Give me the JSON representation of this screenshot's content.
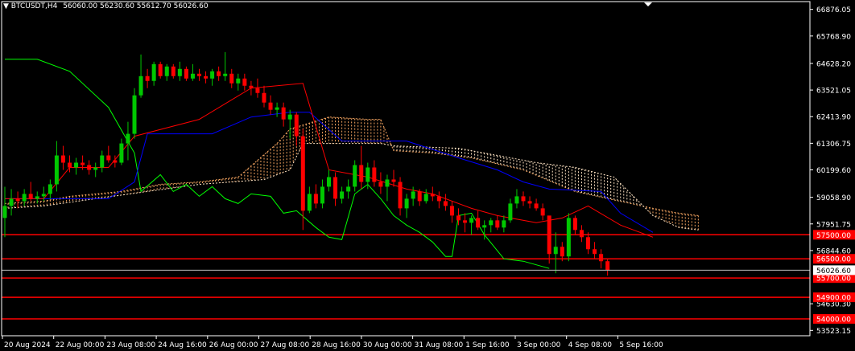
{
  "header": {
    "symbol": "BTCUSDT,H4",
    "ohlc": "56060.00 56230.60 55612.70 56026.60"
  },
  "colors": {
    "background": "#000000",
    "frame": "#ffffff",
    "bull": "#00c800",
    "bear": "#ff0000",
    "tenkan": "#ff0000",
    "kijun": "#0000ff",
    "chikou": "#00ff00",
    "cloud_a": "#f4a460",
    "cloud_b": "#ffe4c4",
    "level_line": "#ff0000",
    "level_text": "#ffffff",
    "current_tag_bg": "#ffffff",
    "current_tag_text": "#000000"
  },
  "price_axis": {
    "ticks": [
      "66876.05",
      "65768.90",
      "64628.20",
      "63521.05",
      "62413.90",
      "61306.75",
      "60199.60",
      "59058.90",
      "57951.75",
      "56844.60",
      "54630.30",
      "53523.15"
    ],
    "current": "56026.60"
  },
  "levels": [
    {
      "price": 57500,
      "label": "57500.00"
    },
    {
      "price": 56500,
      "label": "56500.00"
    },
    {
      "price": 55700,
      "label": "55700.00"
    },
    {
      "price": 54900,
      "label": "54900.00"
    },
    {
      "price": 54000,
      "label": "54000.00"
    }
  ],
  "time_axis": {
    "labels": [
      "20 Aug 2024",
      "22 Aug 00:00",
      "23 Aug 08:00",
      "24 Aug 16:00",
      "26 Aug 00:00",
      "27 Aug 08:00",
      "28 Aug 16:00",
      "30 Aug 00:00",
      "31 Aug 08:00",
      "1 Sep 16:00",
      "3 Sep 00:00",
      "4 Sep 08:00",
      "5 Sep 16:00"
    ]
  },
  "chart_data": {
    "type": "candlestick",
    "indicator": "ichimoku",
    "ylim": [
      53300,
      67200
    ],
    "candles": [
      [
        58200,
        59500,
        57400,
        58700
      ],
      [
        58700,
        59400,
        58300,
        59000
      ],
      [
        59000,
        59300,
        58600,
        58900
      ],
      [
        58900,
        59400,
        58700,
        59200
      ],
      [
        59200,
        59700,
        58900,
        59000
      ],
      [
        59000,
        59300,
        58800,
        59100
      ],
      [
        59100,
        59500,
        58900,
        59200
      ],
      [
        59200,
        59800,
        59000,
        59600
      ],
      [
        59600,
        61400,
        59300,
        60800
      ],
      [
        60800,
        61200,
        60200,
        60500
      ],
      [
        60500,
        60800,
        60100,
        60300
      ],
      [
        60300,
        60700,
        60000,
        60500
      ],
      [
        60500,
        60800,
        60200,
        60400
      ],
      [
        60400,
        60600,
        60000,
        60200
      ],
      [
        60200,
        60500,
        59900,
        60300
      ],
      [
        60300,
        61000,
        60100,
        60800
      ],
      [
        60800,
        61200,
        60500,
        60600
      ],
      [
        60600,
        60800,
        60300,
        60500
      ],
      [
        60500,
        61500,
        60400,
        61300
      ],
      [
        61300,
        62200,
        60600,
        61700
      ],
      [
        61700,
        63600,
        61500,
        63300
      ],
      [
        63300,
        65000,
        63200,
        64100
      ],
      [
        64100,
        64400,
        63600,
        63900
      ],
      [
        63900,
        64700,
        63700,
        64600
      ],
      [
        64600,
        64700,
        64000,
        64100
      ],
      [
        64100,
        64600,
        63900,
        64500
      ],
      [
        64500,
        64600,
        64000,
        64100
      ],
      [
        64100,
        64700,
        63900,
        64400
      ],
      [
        64400,
        64500,
        63900,
        64000
      ],
      [
        64000,
        64600,
        63900,
        64200
      ],
      [
        64200,
        64400,
        63900,
        64100
      ],
      [
        64100,
        64300,
        63800,
        64000
      ],
      [
        64000,
        64400,
        63700,
        64300
      ],
      [
        64300,
        64500,
        63900,
        64100
      ],
      [
        64100,
        65100,
        63900,
        64200
      ],
      [
        64200,
        64400,
        63600,
        63800
      ],
      [
        63800,
        64200,
        63500,
        64000
      ],
      [
        64000,
        64200,
        63500,
        63700
      ],
      [
        63700,
        63900,
        63300,
        63600
      ],
      [
        63600,
        64000,
        63200,
        63400
      ],
      [
        63400,
        63700,
        62800,
        63000
      ],
      [
        63000,
        63300,
        62500,
        62700
      ],
      [
        62700,
        63000,
        62400,
        62800
      ],
      [
        62800,
        63000,
        62000,
        62300
      ],
      [
        62300,
        62700,
        61500,
        62500
      ],
      [
        62500,
        62600,
        61200,
        61600
      ],
      [
        61600,
        61900,
        57700,
        58500
      ],
      [
        58500,
        59500,
        58400,
        59200
      ],
      [
        59200,
        59600,
        58600,
        58800
      ],
      [
        58800,
        59800,
        58600,
        59500
      ],
      [
        59500,
        60200,
        59300,
        59900
      ],
      [
        59900,
        60100,
        58700,
        59000
      ],
      [
        59000,
        59500,
        58800,
        59300
      ],
      [
        59300,
        59800,
        59000,
        59500
      ],
      [
        59500,
        60600,
        59300,
        60400
      ],
      [
        60400,
        61200,
        59400,
        59700
      ],
      [
        59700,
        60500,
        59400,
        60300
      ],
      [
        60300,
        60600,
        59500,
        59700
      ],
      [
        59700,
        60100,
        59200,
        59500
      ],
      [
        59500,
        60000,
        58900,
        59800
      ],
      [
        59800,
        60200,
        59500,
        59700
      ],
      [
        59700,
        59900,
        58300,
        58600
      ],
      [
        58600,
        59200,
        58200,
        59000
      ],
      [
        59000,
        59500,
        58700,
        59300
      ],
      [
        59300,
        59400,
        58700,
        58900
      ],
      [
        58900,
        59400,
        58800,
        59200
      ],
      [
        59200,
        59500,
        58900,
        59100
      ],
      [
        59100,
        59300,
        58600,
        58900
      ],
      [
        58900,
        59200,
        58500,
        58700
      ],
      [
        58700,
        58900,
        58000,
        58300
      ],
      [
        58300,
        58600,
        57900,
        58100
      ],
      [
        58100,
        58400,
        57600,
        58000
      ],
      [
        58000,
        58300,
        57500,
        58200
      ],
      [
        58200,
        58500,
        57700,
        57800
      ],
      [
        57800,
        58100,
        57300,
        57900
      ],
      [
        57900,
        58200,
        57600,
        58100
      ],
      [
        58100,
        58300,
        57700,
        57800
      ],
      [
        57800,
        58300,
        57600,
        58100
      ],
      [
        58100,
        59000,
        58000,
        58800
      ],
      [
        58800,
        59400,
        58600,
        59100
      ],
      [
        59100,
        59300,
        58700,
        58900
      ],
      [
        58900,
        59100,
        58600,
        58800
      ],
      [
        58800,
        59000,
        58500,
        58600
      ],
      [
        58600,
        58800,
        58100,
        58300
      ],
      [
        58300,
        57900,
        56300,
        56700
      ],
      [
        56700,
        57600,
        55900,
        57000
      ],
      [
        57000,
        57200,
        56400,
        56600
      ],
      [
        56600,
        58400,
        56400,
        58200
      ],
      [
        58200,
        58300,
        57500,
        57700
      ],
      [
        57700,
        57900,
        57200,
        57400
      ],
      [
        57400,
        57600,
        56700,
        56900
      ],
      [
        56900,
        57200,
        56500,
        56700
      ],
      [
        56700,
        56900,
        56100,
        56400
      ],
      [
        56400,
        56500,
        55800,
        56026
      ]
    ],
    "tenkan": [
      [
        0,
        59000
      ],
      [
        6,
        59000
      ],
      [
        10,
        60300
      ],
      [
        16,
        60300
      ],
      [
        20,
        61600
      ],
      [
        30,
        62300
      ],
      [
        38,
        63600
      ],
      [
        46,
        63800
      ],
      [
        50,
        60200
      ],
      [
        56,
        59900
      ],
      [
        62,
        59400
      ],
      [
        66,
        59200
      ],
      [
        72,
        58600
      ],
      [
        76,
        58300
      ],
      [
        82,
        58000
      ],
      [
        86,
        58200
      ],
      [
        90,
        58700
      ],
      [
        95,
        57900
      ],
      [
        100,
        57400
      ]
    ],
    "kijun": [
      [
        0,
        59000
      ],
      [
        10,
        59000
      ],
      [
        16,
        59000
      ],
      [
        20,
        59700
      ],
      [
        22,
        61700
      ],
      [
        32,
        61700
      ],
      [
        38,
        62400
      ],
      [
        44,
        62600
      ],
      [
        47,
        62600
      ],
      [
        52,
        61400
      ],
      [
        62,
        61400
      ],
      [
        70,
        60700
      ],
      [
        76,
        60200
      ],
      [
        80,
        59700
      ],
      [
        84,
        59400
      ],
      [
        92,
        59300
      ],
      [
        95,
        58400
      ],
      [
        100,
        57600
      ]
    ],
    "chikou": [
      [
        0,
        64800
      ],
      [
        5,
        64800
      ],
      [
        10,
        64300
      ],
      [
        16,
        62800
      ],
      [
        20,
        60900
      ],
      [
        21,
        59300
      ],
      [
        24,
        60000
      ],
      [
        26,
        59300
      ],
      [
        28,
        59600
      ],
      [
        30,
        59100
      ],
      [
        32,
        59500
      ],
      [
        34,
        59000
      ],
      [
        36,
        58800
      ],
      [
        38,
        59200
      ],
      [
        41,
        59100
      ],
      [
        43,
        58400
      ],
      [
        45,
        58500
      ],
      [
        48,
        57800
      ],
      [
        50,
        57400
      ],
      [
        52,
        57300
      ],
      [
        54,
        59200
      ],
      [
        56,
        59600
      ],
      [
        58,
        59000
      ],
      [
        60,
        58300
      ],
      [
        62,
        57900
      ],
      [
        64,
        57600
      ],
      [
        66,
        57200
      ],
      [
        68,
        56600
      ],
      [
        69,
        56600
      ],
      [
        70,
        58300
      ],
      [
        72,
        58400
      ],
      [
        74,
        57500
      ],
      [
        77,
        56500
      ],
      [
        80,
        56400
      ],
      [
        84,
        56100
      ]
    ],
    "span_a": [
      [
        0,
        58800
      ],
      [
        6,
        58900
      ],
      [
        10,
        59100
      ],
      [
        18,
        59300
      ],
      [
        24,
        59600
      ],
      [
        30,
        59700
      ],
      [
        36,
        59900
      ],
      [
        42,
        61300
      ],
      [
        44,
        61900
      ],
      [
        50,
        62400
      ],
      [
        56,
        62300
      ],
      [
        58,
        62300
      ],
      [
        60,
        61000
      ],
      [
        66,
        60900
      ],
      [
        72,
        60700
      ],
      [
        80,
        60200
      ],
      [
        88,
        59300
      ],
      [
        100,
        58600
      ],
      [
        104,
        58400
      ],
      [
        107,
        58300
      ]
    ],
    "span_b": [
      [
        0,
        58600
      ],
      [
        6,
        58700
      ],
      [
        14,
        59000
      ],
      [
        22,
        59300
      ],
      [
        30,
        59600
      ],
      [
        40,
        59800
      ],
      [
        44,
        60200
      ],
      [
        46,
        61300
      ],
      [
        58,
        61300
      ],
      [
        60,
        61200
      ],
      [
        70,
        61100
      ],
      [
        76,
        60800
      ],
      [
        82,
        60500
      ],
      [
        88,
        60300
      ],
      [
        94,
        59900
      ],
      [
        100,
        58300
      ],
      [
        104,
        57800
      ],
      [
        107,
        57700
      ]
    ]
  }
}
